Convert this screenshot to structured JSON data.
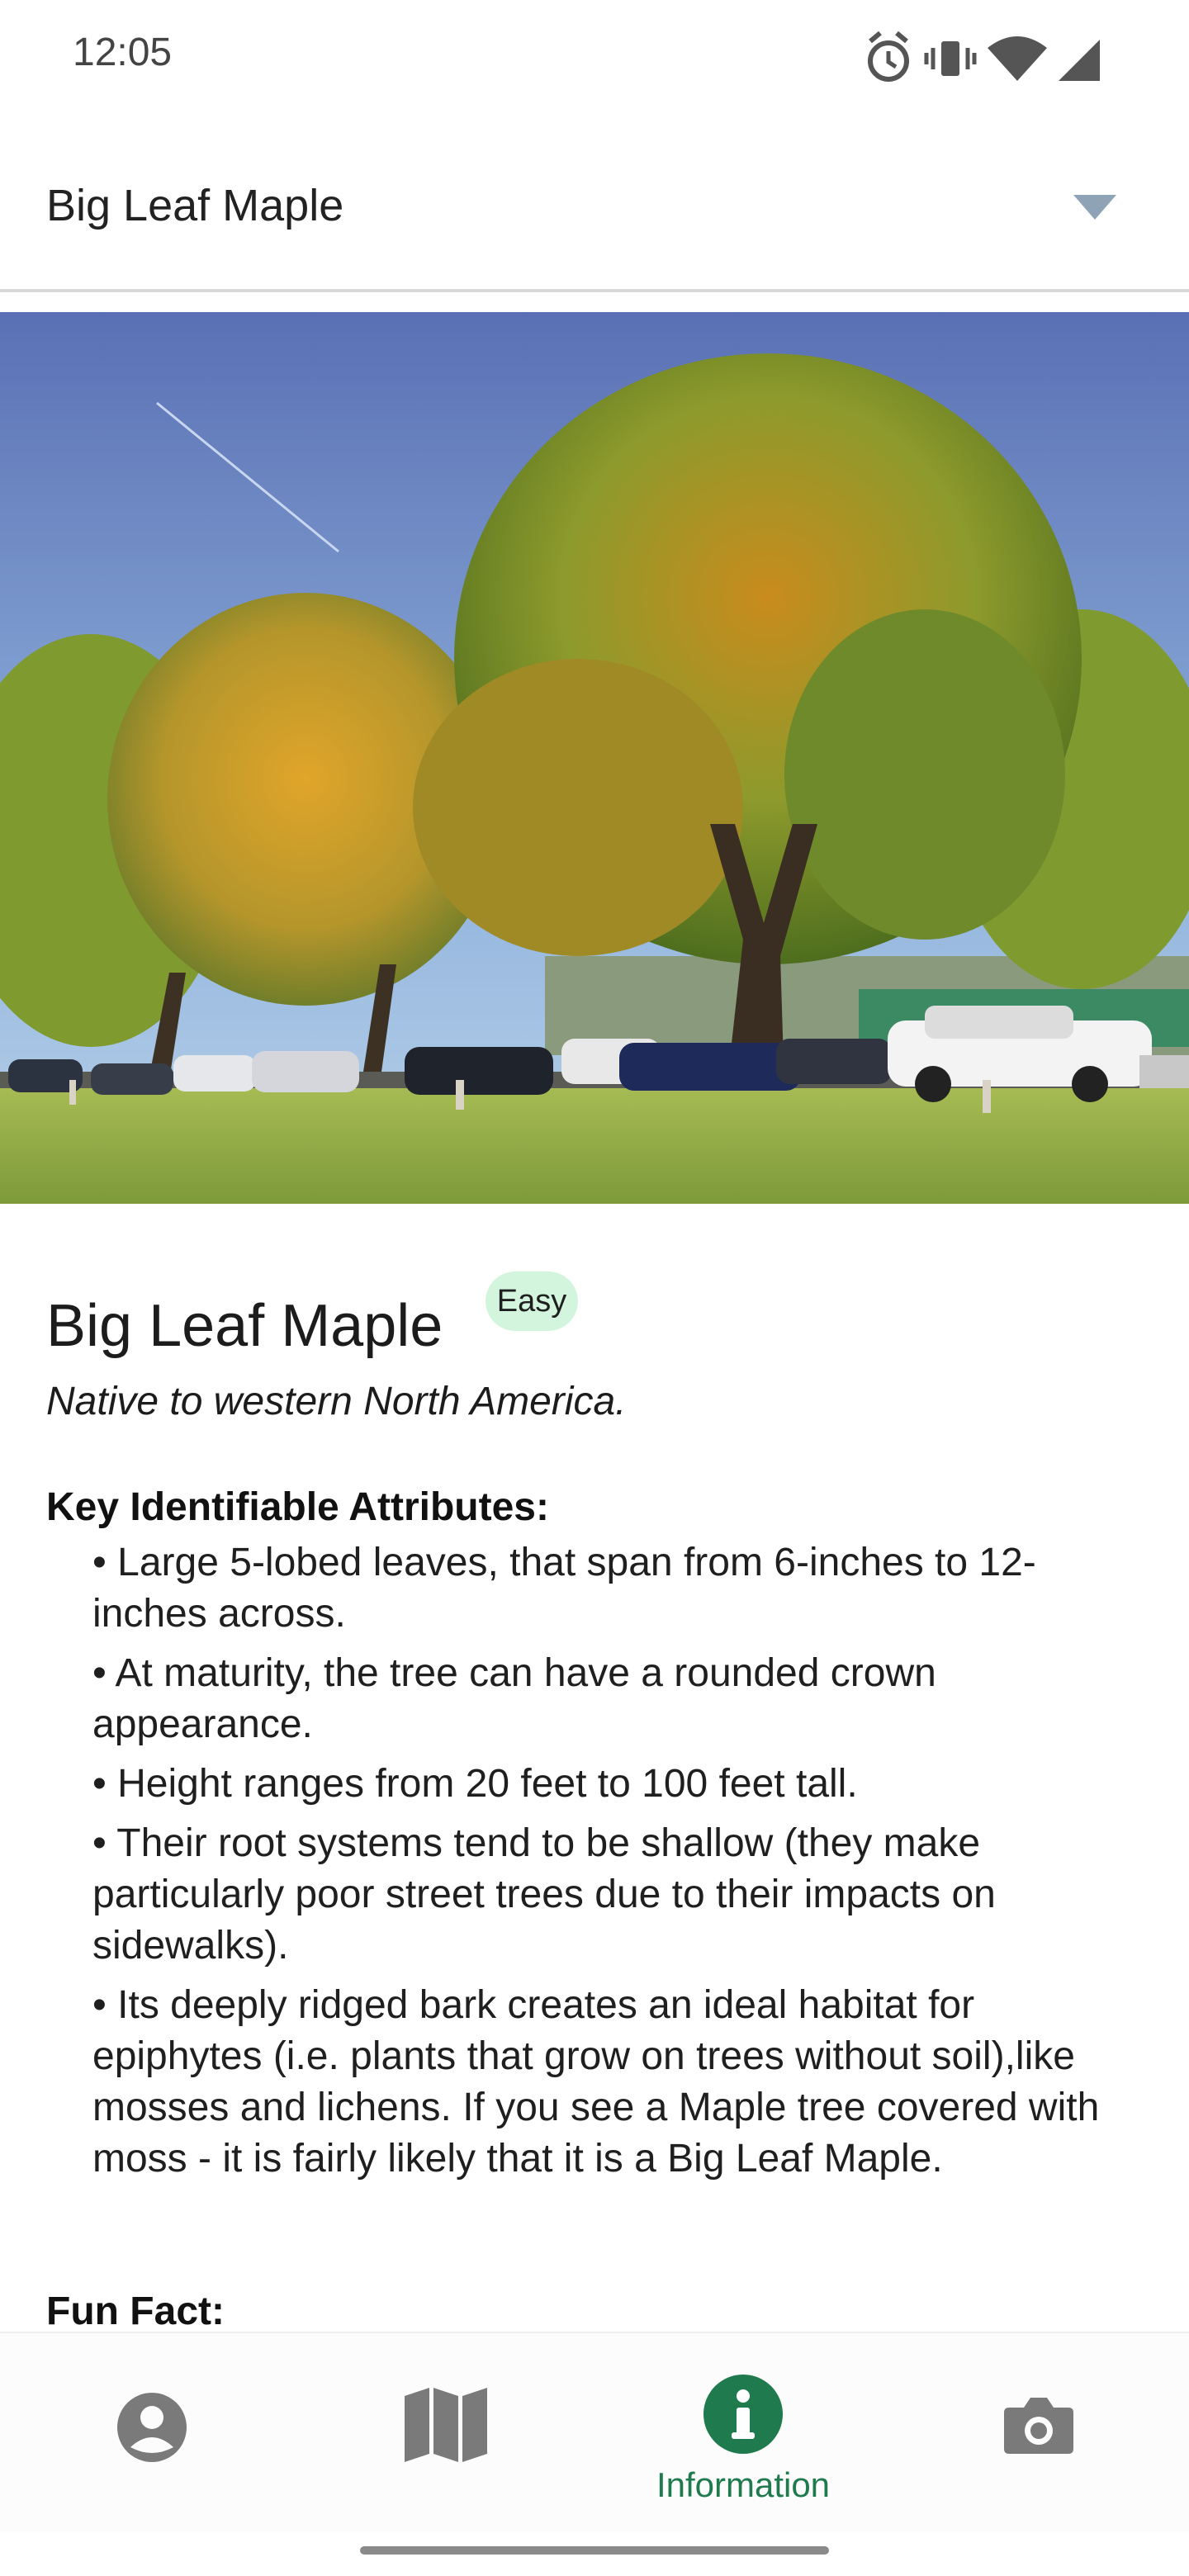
{
  "status_bar": {
    "time": "12:05",
    "icons": [
      "alarm-icon",
      "vibrate-icon",
      "wifi-icon",
      "cellular-signal-icon"
    ]
  },
  "selector": {
    "value": "Big Leaf Maple",
    "icon": "dropdown-arrow-icon"
  },
  "hero_image": {
    "content": "photo of a large maple tree with autumn foliage beside a parking lot"
  },
  "tree": {
    "name": "Big Leaf Maple",
    "difficulty": "Easy",
    "origin": "Native to western North America.",
    "attributes_heading": "Key Identifiable Attributes:",
    "attributes": [
      "• Large 5-lobed leaves, that span from 6-inches to 12-inches across.",
      "• At maturity, the tree can have a rounded crown appearance.",
      "• Height ranges from 20 feet to 100 feet tall.",
      "• Their root systems tend to be shallow (they make particularly poor street trees due to their impacts on sidewalks).",
      "• Its deeply ridged bark creates an ideal habitat for epiphytes (i.e. plants that grow on trees without soil),like mosses and lichens. If you see a Maple tree covered with moss - it is fairly likely that it is a Big Leaf Maple."
    ],
    "fun_fact_heading": "Fun Fact:"
  },
  "bottom_nav": {
    "items": [
      {
        "icon": "profile-icon",
        "label": ""
      },
      {
        "icon": "map-icon",
        "label": ""
      },
      {
        "icon": "information-icon",
        "label": "Information",
        "active": true
      },
      {
        "icon": "camera-icon",
        "label": ""
      }
    ],
    "active_color": "#1f7a4d",
    "inactive_color": "#7a7a7a"
  }
}
